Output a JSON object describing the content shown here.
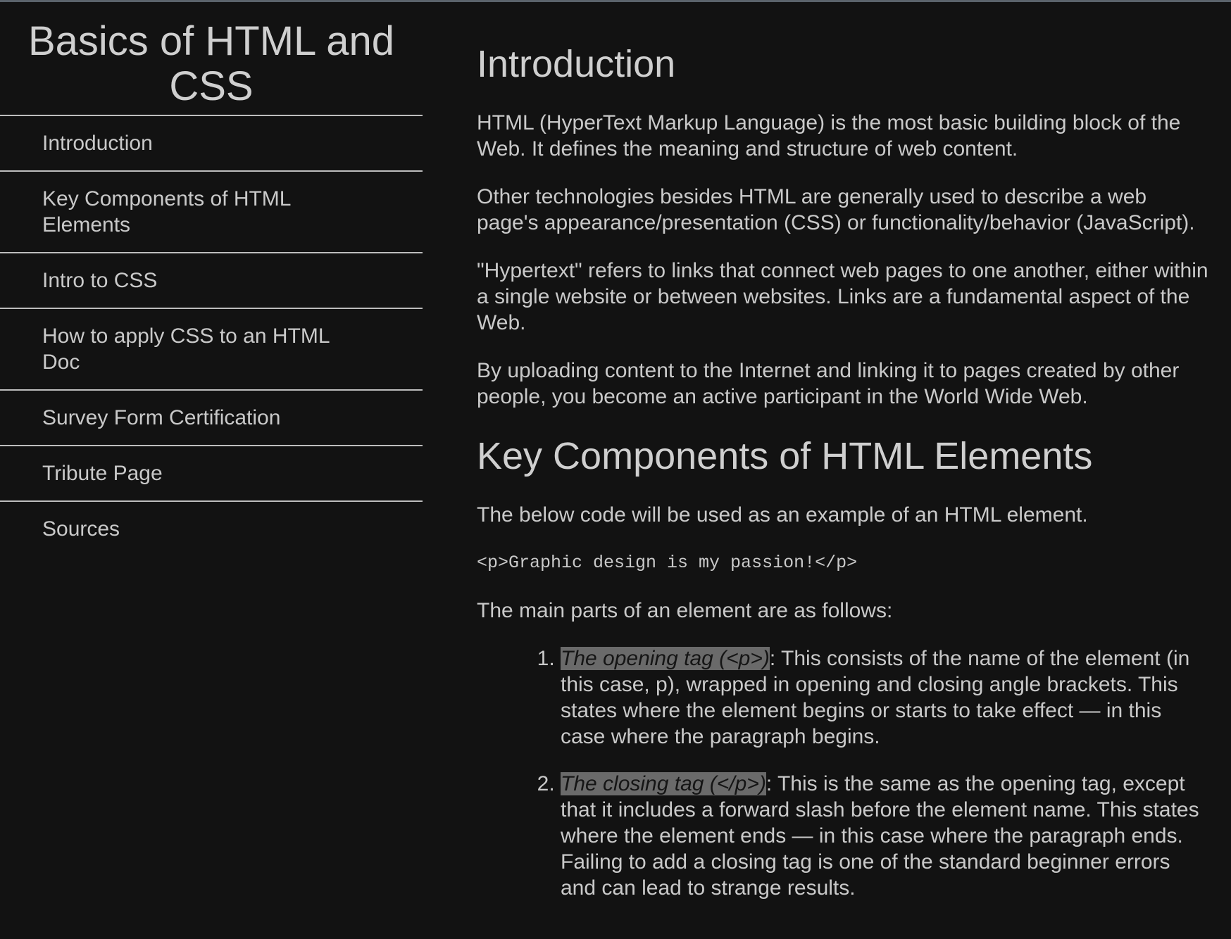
{
  "sidebar": {
    "title": "Basics of HTML and CSS",
    "items": [
      {
        "label": "Introduction"
      },
      {
        "label": "Key Components of HTML Elements"
      },
      {
        "label": "Intro to CSS"
      },
      {
        "label": "How to apply CSS to an HTML Doc"
      },
      {
        "label": "Survey Form Certification"
      },
      {
        "label": "Tribute Page"
      },
      {
        "label": "Sources"
      }
    ]
  },
  "main": {
    "introduction": {
      "title": "Introduction",
      "paragraphs": [
        "HTML (HyperText Markup Language) is the most basic building block of the Web. It defines the meaning and structure of web content.",
        "Other technologies besides HTML are generally used to describe a web page's appearance/presentation (CSS) or functionality/behavior (JavaScript).",
        "\"Hypertext\" refers to links that connect web pages to one another, either within a single website or between websites. Links are a fundamental aspect of the Web.",
        "By uploading content to the Internet and linking it to pages created by other people, you become an active participant in the World Wide Web."
      ]
    },
    "key_components": {
      "title": "Key Components of HTML Elements",
      "intro": "The below code will be used as an example of an HTML element.",
      "code": "<p>Graphic design is my passion!</p>",
      "list_intro": "The main parts of an element are as follows:",
      "items": [
        {
          "term": "The opening tag (<p>)",
          "text": ": This consists of the name of the element (in this case, p), wrapped in opening and closing angle brackets. This states where the element begins or starts to take effect — in this case where the paragraph begins."
        },
        {
          "term": "The closing tag (</p>)",
          "text": ": This is the same as the opening tag, except that it includes a forward slash before the element name. This states where the element ends — in this case where the paragraph ends. Failing to add a closing tag is one of the standard beginner errors and can lead to strange results."
        }
      ]
    }
  },
  "colors": {
    "background": "#121212",
    "text": "#c9c9c9",
    "highlight": "#6a6a6a",
    "divider": "#bdbdbd"
  }
}
